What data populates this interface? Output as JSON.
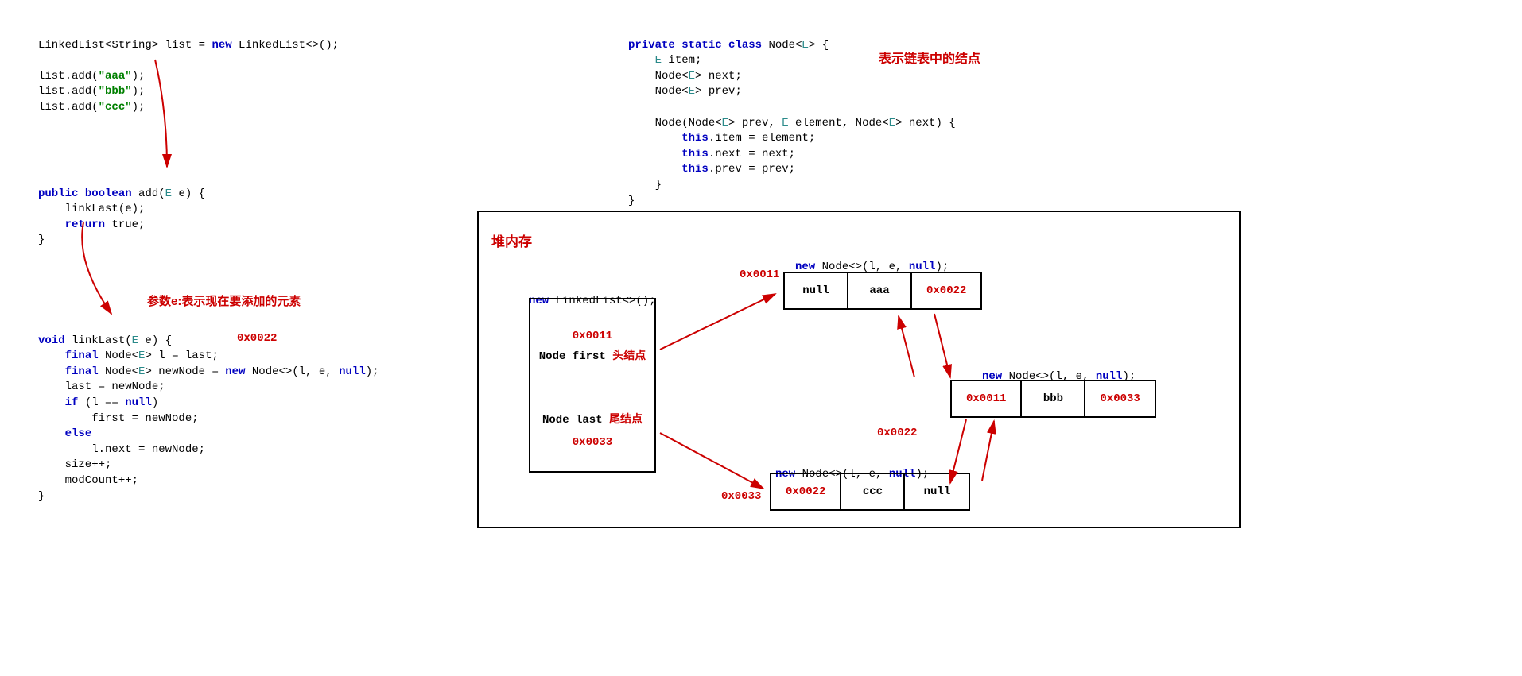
{
  "code1": {
    "line1a": "LinkedList<String> list = ",
    "line1_new": "new",
    "line1b": " LinkedList<>();",
    "line2": "list.add(",
    "line2s": "\"aaa\"",
    "line2e": ");",
    "line3": "list.add(",
    "line3s": "\"bbb\"",
    "line3e": ");",
    "line4": "list.add(",
    "line4s": "\"ccc\"",
    "line4e": ");"
  },
  "code2": {
    "kw_public": "public",
    "kw_boolean": "boolean",
    "m_add": " add(",
    "gen_E": "E",
    "p_e": " e) {",
    "linkLast": "    linkLast(e);",
    "kw_return": "return",
    "ret": " true;",
    "close": "}"
  },
  "annParam": "参数e:表示现在要添加的元素",
  "addr0022": "0x0022",
  "code3": {
    "kw_void": "void",
    "m_name": " linkLast(",
    "gen_E": "E",
    "p_e": " e) {",
    "kw_final": "final",
    "typeNode": " Node<",
    "gen_E2": "E",
    "close_gen": "> ",
    "l": "l = last;",
    "newNode": "newNode = ",
    "kw_new": "new",
    "nodeCtor": " Node<>(l, e, ",
    "kw_null": "null",
    "closeCall": ");",
    "last_assign": "    last = newNode;",
    "kw_if": "if",
    "cond": " (l == ",
    "kw_null2": "null",
    "closeCond": ")",
    "first_assign": "        first = newNode;",
    "kw_else": "else",
    "lnext": "        l.next = newNode;",
    "size": "    size++;",
    "mod": "    modCount++;",
    "close": "}"
  },
  "code4": {
    "kw_private": "private",
    "kw_static": "static",
    "kw_class": "class",
    "cl_Node": " Node<",
    "gen_E": "E",
    "close_gen": "> {",
    "gen_E2": "E",
    "f_item": " item;",
    "typeNode": "    Node<",
    "gen_E3": "E",
    "close_gen2": "> ",
    "f_next": "next;",
    "f_prev": "prev;",
    "ctor": "    Node(Node<",
    "gen_E4": "E",
    "ctor2": "> prev, ",
    "gen_E5": "E",
    "ctor3": " element, Node<",
    "gen_E6": "E",
    "ctor4": "> next) {",
    "kw_this": "this",
    "a_item": ".item = element;",
    "a_next": ".next = next;",
    "a_prev": ".prev = prev;",
    "close_ctor": "    }",
    "close_class": "}"
  },
  "annNode": "表示链表中的结点",
  "heap": {
    "title": "堆内存",
    "newLL": "new",
    "newLL2": " LinkedList<>();",
    "addr0011": "0x0011",
    "firstLabel": "Node first",
    "headAnn": "头结点",
    "lastLabel": "Node last",
    "tailAnn": "尾结点",
    "addr0033": "0x0033",
    "newNode": "new",
    "newNode2": " Node<>(l, e, ",
    "newNode_null": "null",
    "newNode3": ");",
    "node1": {
      "prev": "null",
      "item": "aaa",
      "next": "0x0022",
      "addr": "0x0011"
    },
    "node2": {
      "prev": "0x0011",
      "item": "bbb",
      "next": "0x0033",
      "addr": "0x0022"
    },
    "node3": {
      "prev": "0x0022",
      "item": "ccc",
      "next": "null",
      "addr": "0x0033"
    }
  }
}
